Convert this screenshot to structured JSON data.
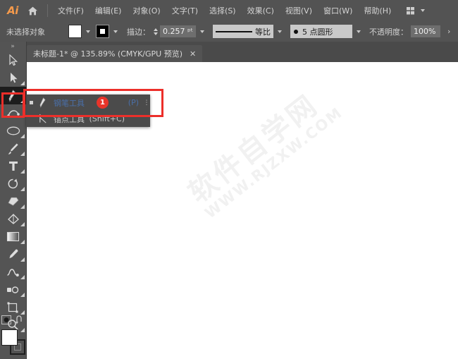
{
  "app": {
    "logo_text": "Ai",
    "home_icon": "home-icon",
    "workspace_icon": "workspace-switcher-icon"
  },
  "menubar": {
    "items": [
      {
        "label": "文件(F)",
        "name": "menu-file"
      },
      {
        "label": "编辑(E)",
        "name": "menu-edit"
      },
      {
        "label": "对象(O)",
        "name": "menu-object"
      },
      {
        "label": "文字(T)",
        "name": "menu-type"
      },
      {
        "label": "选择(S)",
        "name": "menu-select"
      },
      {
        "label": "效果(C)",
        "name": "menu-effect"
      },
      {
        "label": "视图(V)",
        "name": "menu-view"
      },
      {
        "label": "窗口(W)",
        "name": "menu-window"
      },
      {
        "label": "帮助(H)",
        "name": "menu-help"
      }
    ]
  },
  "controlbar": {
    "selection_label": "未选择对象",
    "fill_color": "#ffffff",
    "stroke_color": "#000000",
    "stroke_label": "描边：",
    "stroke_weight": "0.257 ᵖᵗ",
    "profile_label": "等比",
    "brush_label": "5 点圆形",
    "opacity_label": "不透明度：",
    "opacity_value": "100%",
    "overflow_chevron": "›"
  },
  "tabbar": {
    "tab_title": "未标题-1* @ 135.89% (CMYK/GPU 预览)",
    "close_label": "✕"
  },
  "toolbar": {
    "grip": "»",
    "tools": [
      {
        "name": "selection-tool",
        "icon": "arrow-select-icon",
        "active": false,
        "flyout": false
      },
      {
        "name": "direct-selection-tool",
        "icon": "direct-select-arrow-icon",
        "active": false,
        "flyout": true
      },
      {
        "name": "pen-tool",
        "icon": "pen-icon",
        "active": true,
        "flyout": true
      },
      {
        "name": "curvature-tool",
        "icon": "curvature-icon",
        "active": false,
        "flyout": false
      },
      {
        "name": "ellipse-tool",
        "icon": "ellipse-icon",
        "active": false,
        "flyout": true
      },
      {
        "name": "paintbrush-tool",
        "icon": "paintbrush-icon",
        "active": false,
        "flyout": true
      },
      {
        "name": "type-tool",
        "icon": "type-t-icon",
        "active": false,
        "flyout": true
      },
      {
        "name": "rotate-tool",
        "icon": "rotate-icon",
        "active": false,
        "flyout": true
      },
      {
        "name": "eraser-tool",
        "icon": "eraser-icon",
        "active": false,
        "flyout": true
      },
      {
        "name": "scale-tool",
        "icon": "scale-shear-icon",
        "active": false,
        "flyout": true
      },
      {
        "name": "gradient-tool",
        "icon": "gradient-icon",
        "active": false,
        "flyout": true
      },
      {
        "name": "eyedropper-tool",
        "icon": "eyedropper-icon",
        "active": false,
        "flyout": true
      },
      {
        "name": "blend-tool",
        "icon": "blend-icon",
        "active": false,
        "flyout": true
      },
      {
        "name": "symbol-sprayer-tool",
        "icon": "symbol-sprayer-icon",
        "active": false,
        "flyout": true
      },
      {
        "name": "artboard-tool",
        "icon": "artboard-icon",
        "active": false,
        "flyout": true
      },
      {
        "name": "zoom-tool",
        "icon": "magnifier-icon",
        "active": false,
        "flyout": true
      }
    ],
    "bottom": {
      "color_mode_icon": "color-mode-icon",
      "swap_icon": "swap-fill-stroke-icon",
      "fill_color": "#ffffff",
      "stroke_color": "#000000"
    }
  },
  "flyout": {
    "items": [
      {
        "name": "flyout-item-pen-tool",
        "icon": "pen-icon",
        "label": "钢笔工具",
        "shortcut": "(P)",
        "badge": "1",
        "selected": true
      },
      {
        "name": "flyout-item-anchor-point-tool",
        "icon": "anchor-point-icon",
        "label": "锚点工具",
        "shortcut": "(Shift+C)",
        "badge": "",
        "selected": false
      }
    ]
  },
  "canvas": {
    "watermark_line1": "软件自学网",
    "watermark_line2": "WWW.RJZXW.COM"
  }
}
